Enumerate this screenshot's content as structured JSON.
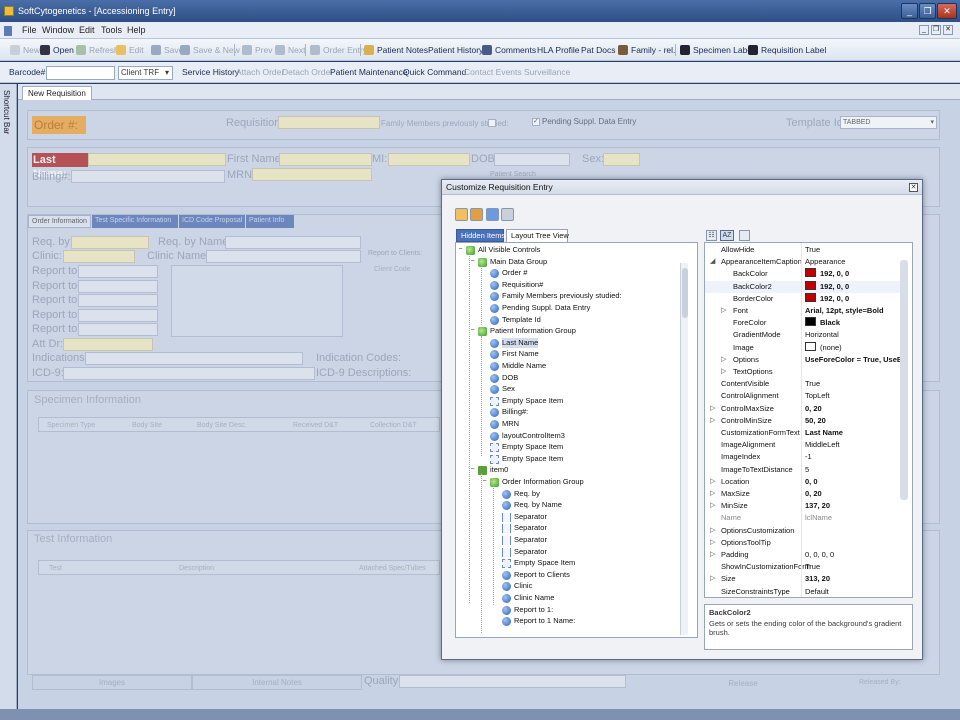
{
  "window": {
    "title": "SoftCytogenetics - [Accessioning Entry]",
    "min": "_",
    "restore": "❐",
    "close": "✕"
  },
  "menu": [
    "File",
    "Window",
    "Edit",
    "Tools",
    "Help"
  ],
  "toolbar": [
    {
      "label": "New",
      "enabled": false,
      "icon": "new-icon"
    },
    {
      "label": "Open",
      "enabled": true,
      "icon": "binoculars-icon"
    },
    {
      "label": "Refresh",
      "enabled": false,
      "icon": "refresh-icon"
    },
    {
      "label": "Edit",
      "enabled": false,
      "icon": "edit-icon"
    },
    {
      "label": "Save",
      "enabled": false,
      "icon": "save-icon"
    },
    {
      "label": "Save & New",
      "enabled": false,
      "icon": "save-new-icon"
    },
    {
      "label": "Prev",
      "enabled": false,
      "icon": "prev-icon"
    },
    {
      "label": "Next",
      "enabled": false,
      "icon": "next-icon"
    },
    {
      "label": "Order Entry",
      "enabled": false,
      "icon": "order-entry-icon"
    },
    {
      "label": "Patient Notes",
      "enabled": true,
      "icon": "notes-icon"
    },
    {
      "label": "Patient History",
      "enabled": true,
      "icon": ""
    },
    {
      "label": "Comments",
      "enabled": true,
      "icon": "comments-icon"
    },
    {
      "label": "HLA Profile",
      "enabled": true,
      "icon": ""
    },
    {
      "label": "Pat Docs",
      "enabled": true,
      "icon": ""
    },
    {
      "label": "Family - rel.",
      "enabled": true,
      "icon": "family-icon"
    },
    {
      "label": "Specimen Label",
      "enabled": true,
      "icon": "barcode-icon"
    },
    {
      "label": "Requisition Label",
      "enabled": true,
      "icon": "barcode-icon"
    }
  ],
  "barcodebar": {
    "barcode_label": "Barcode#:",
    "client_trf": "Client TRF",
    "links": [
      {
        "label": "Service History",
        "enabled": true
      },
      {
        "label": "Attach Order",
        "enabled": false
      },
      {
        "label": "Detach Order",
        "enabled": false
      },
      {
        "label": "Patient Maintenance",
        "enabled": true
      },
      {
        "label": "Quick Command",
        "enabled": true
      },
      {
        "label": "Contact Events Surveillance",
        "enabled": false
      }
    ]
  },
  "shortcut_bar": "Shortcut Bar",
  "doc_tab": "New Requisition",
  "form": {
    "order": "Order #:",
    "requisition": "Requisition#:",
    "family_prev": "Family Members previously studied:",
    "pending": "Pending Suppl. Data Entry",
    "template_id": "Template Id:",
    "template_value": "TABBED",
    "last_name": "Last Name:",
    "first_name": "First Name:",
    "mi": "MI:",
    "dob": "DOB:",
    "sex": "Sex:",
    "billing": "Billing#:",
    "mrn": "MRN:",
    "patient_search": "Patient Search",
    "tabs": [
      "Order Information",
      "Test Specific Information",
      "ICD Code Proposal",
      "Patient Info"
    ],
    "req_by": "Req. by:",
    "req_by_name": "Req. by Name:",
    "clinic": "Clinic:",
    "clinic_name": "Clinic Name:",
    "report_to": "Report to:",
    "report_to_clients": "Report to Clients:",
    "client_code": "Client Code",
    "att_dr": "Att Dr:",
    "indications": "Indications:",
    "indication_codes": "Indication Codes:",
    "icd9": "ICD-9:",
    "icd9_desc": "ICD-9 Descriptions:",
    "specimen_info": "Specimen Information",
    "specimen_cols": [
      "Specimen Type",
      "Body Site",
      "Body Site Desc.",
      "Received D&T",
      "Collection D&T"
    ],
    "test_info": "Test Information",
    "test_cols": [
      "Test",
      "Description",
      "Attached Spec/Tubes"
    ],
    "images": "Images",
    "internal_notes": "Internal Notes",
    "quality": "Quality:",
    "release": "Release",
    "released_by": "Released By:"
  },
  "dialog": {
    "title": "Customize Requisition Entry",
    "close": "✕",
    "tabs": [
      "Hidden Items",
      "Layout Tree View"
    ],
    "tree": [
      {
        "label": "All Visible Controls",
        "level": 0,
        "icon": "group",
        "exp": "−"
      },
      {
        "label": "Main Data Group",
        "level": 1,
        "icon": "group",
        "exp": "−"
      },
      {
        "label": "Order #",
        "level": 2,
        "icon": "field"
      },
      {
        "label": "Requisition#",
        "level": 2,
        "icon": "field"
      },
      {
        "label": "Family Members previously studied:",
        "level": 2,
        "icon": "field"
      },
      {
        "label": "Pending Suppl. Data Entry",
        "level": 2,
        "icon": "field"
      },
      {
        "label": "Template Id",
        "level": 2,
        "icon": "field"
      },
      {
        "label": "Patient Information Group",
        "level": 1,
        "icon": "group",
        "exp": "−"
      },
      {
        "label": "Last Name",
        "level": 2,
        "icon": "field",
        "selected": true
      },
      {
        "label": "First Name",
        "level": 2,
        "icon": "field"
      },
      {
        "label": "Middle Name",
        "level": 2,
        "icon": "field"
      },
      {
        "label": "DOB",
        "level": 2,
        "icon": "field"
      },
      {
        "label": "Sex",
        "level": 2,
        "icon": "field"
      },
      {
        "label": "Empty Space Item",
        "level": 2,
        "icon": "empty"
      },
      {
        "label": "Billing#:",
        "level": 2,
        "icon": "field"
      },
      {
        "label": "MRN",
        "level": 2,
        "icon": "field"
      },
      {
        "label": "layoutControlItem3",
        "level": 2,
        "icon": "field"
      },
      {
        "label": "Empty Space Item",
        "level": 2,
        "icon": "empty"
      },
      {
        "label": "Empty Space Item",
        "level": 2,
        "icon": "empty"
      },
      {
        "label": "item0",
        "level": 1,
        "icon": "tab",
        "exp": "−"
      },
      {
        "label": "Order Information Group",
        "level": 2,
        "icon": "group",
        "exp": "−"
      },
      {
        "label": "Req. by",
        "level": 3,
        "icon": "field"
      },
      {
        "label": "Req. by Name",
        "level": 3,
        "icon": "field"
      },
      {
        "label": "Separator",
        "level": 3,
        "icon": "sep"
      },
      {
        "label": "Separator",
        "level": 3,
        "icon": "sep"
      },
      {
        "label": "Separator",
        "level": 3,
        "icon": "sep"
      },
      {
        "label": "Separator",
        "level": 3,
        "icon": "sep"
      },
      {
        "label": "Empty Space Item",
        "level": 3,
        "icon": "empty"
      },
      {
        "label": "Report to Clients",
        "level": 3,
        "icon": "field"
      },
      {
        "label": "Clinic",
        "level": 3,
        "icon": "field"
      },
      {
        "label": "Clinic Name",
        "level": 3,
        "icon": "field"
      },
      {
        "label": "Report to 1:",
        "level": 3,
        "icon": "field"
      },
      {
        "label": "Report to 1 Name:",
        "level": 3,
        "icon": "field"
      }
    ],
    "props": [
      {
        "name": "AllowHide",
        "value": "True"
      },
      {
        "name": "AppearanceItemCaption",
        "value": "Appearance",
        "exp": "◢"
      },
      {
        "name": "BackColor",
        "value": "192, 0, 0",
        "bold": true,
        "swatch": "#c00000",
        "indent": 1
      },
      {
        "name": "BackColor2",
        "value": "192, 0, 0",
        "bold": true,
        "swatch": "#c00000",
        "indent": 1,
        "selected": true
      },
      {
        "name": "BorderColor",
        "value": "192, 0, 0",
        "bold": true,
        "swatch": "#c00000",
        "indent": 1
      },
      {
        "name": "Font",
        "value": "Arial, 12pt, style=Bold",
        "bold": true,
        "indent": 1,
        "exp": "▷"
      },
      {
        "name": "ForeColor",
        "value": "Black",
        "bold": true,
        "swatch": "#000000",
        "indent": 1
      },
      {
        "name": "GradientMode",
        "value": "Horizontal",
        "indent": 1
      },
      {
        "name": "Image",
        "value": "(none)",
        "swatch": "#ffffff",
        "indent": 1
      },
      {
        "name": "Options",
        "value": "UseForeColor = True, UseB",
        "bold": true,
        "indent": 1,
        "exp": "▷"
      },
      {
        "name": "TextOptions",
        "value": "",
        "indent": 1,
        "exp": "▷"
      },
      {
        "name": "ContentVisible",
        "value": "True"
      },
      {
        "name": "ControlAlignment",
        "value": "TopLeft"
      },
      {
        "name": "ControlMaxSize",
        "value": "0, 20",
        "bold": true,
        "exp": "▷"
      },
      {
        "name": "ControlMinSize",
        "value": "50, 20",
        "bold": true,
        "exp": "▷"
      },
      {
        "name": "CustomizationFormText",
        "value": "Last Name",
        "bold": true
      },
      {
        "name": "ImageAlignment",
        "value": "MiddleLeft"
      },
      {
        "name": "ImageIndex",
        "value": "-1"
      },
      {
        "name": "ImageToTextDistance",
        "value": "5"
      },
      {
        "name": "Location",
        "value": "0, 0",
        "bold": true,
        "exp": "▷"
      },
      {
        "name": "MaxSize",
        "value": "0, 20",
        "bold": true,
        "exp": "▷"
      },
      {
        "name": "MinSize",
        "value": "137, 20",
        "bold": true,
        "exp": "▷"
      },
      {
        "name": "Name",
        "value": "lclName",
        "grey": true
      },
      {
        "name": "OptionsCustomization",
        "value": "",
        "exp": "▷"
      },
      {
        "name": "OptionsToolTip",
        "value": "",
        "exp": "▷"
      },
      {
        "name": "Padding",
        "value": "0, 0, 0, 0",
        "exp": "▷"
      },
      {
        "name": "ShowInCustomizationForm",
        "value": "True"
      },
      {
        "name": "Size",
        "value": "313, 20",
        "bold": true,
        "exp": "▷"
      },
      {
        "name": "SizeConstraintsType",
        "value": "Default"
      }
    ],
    "desc_title": "BackColor2",
    "desc_text": "Gets or sets the ending color of the background's gradient brush."
  }
}
